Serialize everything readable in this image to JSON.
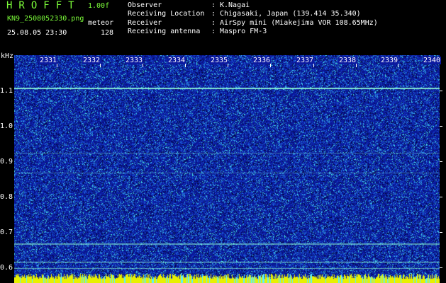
{
  "header": {
    "logo": "HROFFT",
    "version": "1.00f",
    "filename": "KN9_2508052330.png",
    "mode": "meteor",
    "datetime": "25.08.05 23:30",
    "fft_size": "128"
  },
  "info": [
    {
      "label": "Observer",
      "value": "K.Nagai"
    },
    {
      "label": "Receiving Location",
      "value": "Chigasaki, Japan (139.414 35.340)"
    },
    {
      "label": "Receiver",
      "value": "AirSpy mini (Miakejima VOR 108.65MHz)"
    },
    {
      "label": "Receiving antenna",
      "value": "Maspro FM-3"
    }
  ],
  "separator": ":",
  "y_unit": "kHz",
  "y_axis": [
    {
      "label": "1.1",
      "value": 1.1
    },
    {
      "label": "1.0",
      "value": 1.0
    },
    {
      "label": "0.9",
      "value": 0.9
    },
    {
      "label": "0.8",
      "value": 0.8
    },
    {
      "label": "0.7",
      "value": 0.7
    },
    {
      "label": "0.6",
      "value": 0.6
    }
  ],
  "x_axis": [
    "2331",
    "2332",
    "2333",
    "2334",
    "2335",
    "2336",
    "2337",
    "2338",
    "2339",
    "2340"
  ],
  "colors": {
    "background": "#000000",
    "plot_bg": "#0c1aa0",
    "logo": "#7dff3a",
    "carrier": "#8fffd8",
    "bottom_strip": "#e8f000"
  }
}
